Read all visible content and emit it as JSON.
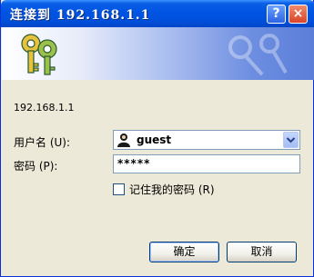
{
  "window": {
    "title": "连接到 192.168.1.1"
  },
  "titlebar_buttons": {
    "help": "?",
    "close": "×"
  },
  "banner": {
    "icon": "keys-icon"
  },
  "dialog": {
    "host_label": "192.168.1.1",
    "username_label": "用户名 (U):",
    "username_value": "guest",
    "password_label": "密码 (P):",
    "password_value": "*****",
    "remember_label": "记住我的密码 (R)",
    "remember_checked": false
  },
  "buttons": {
    "ok": "确定",
    "cancel": "取消"
  },
  "colors": {
    "titlebar": "#0054e3",
    "dialog_bg": "#ece9d8",
    "input_border": "#7f9db9"
  }
}
